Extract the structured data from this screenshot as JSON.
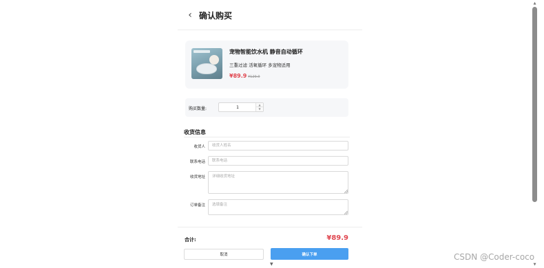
{
  "header": {
    "back_icon": "chevron-left-icon",
    "title": "确认购买"
  },
  "product": {
    "image_icon": "pet-water-fountain-image",
    "name": "宠物智能饮水机 静音自动循环",
    "description": "三重过滤 活氧循环 多宠物适用",
    "price": "¥89.9",
    "original_price": "¥129.9"
  },
  "quantity": {
    "label": "购买数量:",
    "value": "1"
  },
  "shipping": {
    "title": "收货信息",
    "fields": [
      {
        "label": "收货人",
        "placeholder": "收货人姓名",
        "value": ""
      },
      {
        "label": "联系电话",
        "placeholder": "联系电话",
        "value": ""
      },
      {
        "label": "收货地址",
        "placeholder": "详细收货地址",
        "value": ""
      },
      {
        "label": "订单备注",
        "placeholder": "选填备注",
        "value": ""
      }
    ]
  },
  "summary": {
    "total_label": "合计:",
    "total_value": "¥89.9"
  },
  "actions": {
    "cancel_label": "取消",
    "confirm_label": "确认下单"
  },
  "watermark": "CSDN @Coder-coco",
  "colors": {
    "price": "#e0464f",
    "confirm_button": "#4a9ff0",
    "card_background": "#f6f7f9"
  }
}
